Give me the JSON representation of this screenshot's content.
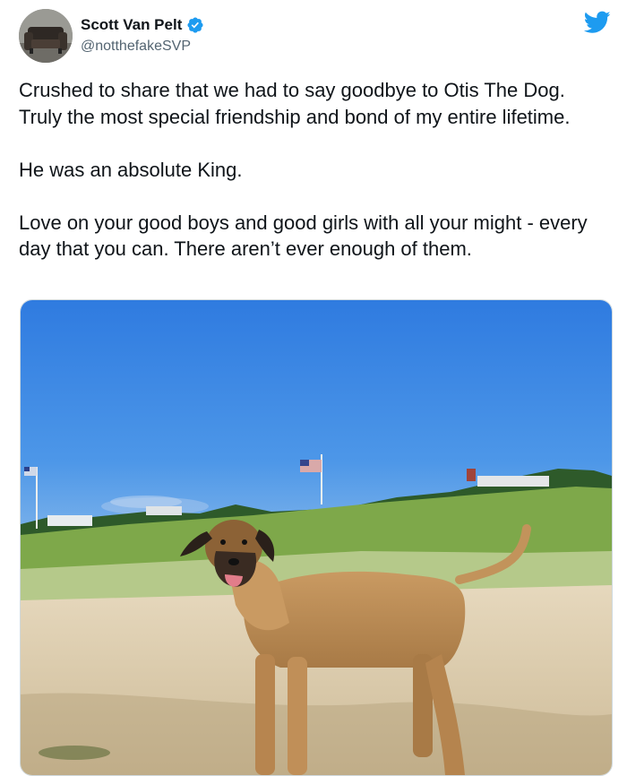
{
  "author": {
    "display_name": "Scott Van Pelt",
    "handle": "@notthefakeSVP",
    "verified": true,
    "avatar_icon": "armchair-photo-avatar"
  },
  "platform_icon": "twitter-bird-icon",
  "tweet": {
    "paragraphs": [
      "Crushed to share that we had to say goodbye to Otis The Dog. Truly the most special friendship and bond of my entire lifetime.",
      "He was an absolute King.",
      "Love on your good boys and good girls with all your might - every day that you can. There aren’t ever enough of them."
    ]
  },
  "media": {
    "scene": "dog-on-beach-photo"
  },
  "colors": {
    "brand_blue": "#1d9bf0",
    "text": "#0f1419",
    "secondary_text": "#536471"
  }
}
